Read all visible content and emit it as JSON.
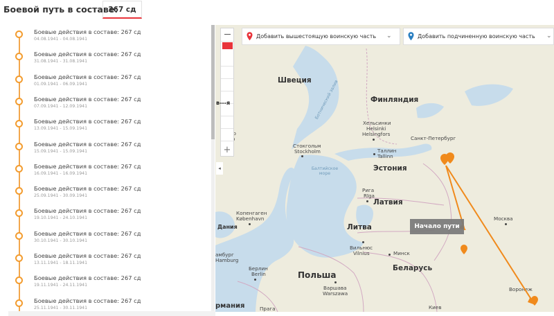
{
  "header": {
    "title": "Боевой путь в составе:",
    "unit_tab": "267 сд"
  },
  "timeline": {
    "items": [
      {
        "title": "Боевые действия в составе: 267 сд",
        "dates": "04.08.1941 - 04.08.1941"
      },
      {
        "title": "Боевые действия в составе: 267 сд",
        "dates": "31.08.1941 - 31.08.1941"
      },
      {
        "title": "Боевые действия в составе: 267 сд",
        "dates": "01.09.1941 - 06.09.1941"
      },
      {
        "title": "Боевые действия в составе: 267 сд",
        "dates": "07.09.1941 - 12.09.1941"
      },
      {
        "title": "Боевые действия в составе: 267 сд",
        "dates": "13.09.1941 - 15.09.1941"
      },
      {
        "title": "Боевые действия в составе: 267 сд",
        "dates": "15.09.1941 - 15.09.1941"
      },
      {
        "title": "Боевые действия в составе: 267 сд",
        "dates": "16.09.1941 - 16.09.1941"
      },
      {
        "title": "Боевые действия в составе: 267 сд",
        "dates": "25.09.1941 - 30.09.1941"
      },
      {
        "title": "Боевые действия в составе: 267 сд",
        "dates": "19.10.1941 - 24.10.1941"
      },
      {
        "title": "Боевые действия в составе: 267 сд",
        "dates": "30.10.1941 - 30.10.1941"
      },
      {
        "title": "Боевые действия в составе: 267 сд",
        "dates": "13.11.1941 - 18.11.1941"
      },
      {
        "title": "Боевые действия в составе: 267 сд",
        "dates": "19.11.1941 - 24.11.1941"
      },
      {
        "title": "Боевые действия в составе: 267 сд",
        "dates": "25.11.1941 - 30.11.1941"
      }
    ]
  },
  "toolbar": {
    "add_parent_label": "Добавить вышестоящую воинскую часть",
    "add_child_label": "Добавить подчиненную воинскую часть",
    "parent_pin_color": "#e8333a",
    "child_pin_color": "#2a7fc1"
  },
  "map": {
    "start_tooltip": "Начало пути",
    "route_color": "#f08a1c",
    "labels": {
      "sweden": "Швеция",
      "finland": "Финляндия",
      "estonia": "Эстония",
      "latvia": "Латвия",
      "lithuania": "Литва",
      "belarus": "Беларусь",
      "poland": "Польша",
      "denmark": "Дания",
      "germany_partial": "рмания",
      "helsinki": "Хельсинки",
      "helsinki_alt": "Helsinki",
      "helsingfors": "Helsingfors",
      "stockholm": "Стокгольм",
      "stockholm_alt": "Stockholm",
      "tallinn": "Таллин",
      "tallinn_alt": "Tallinn",
      "stpetersburg": "Санкт-Петербург",
      "riga": "Рига",
      "riga_alt": "Rīga",
      "copenhagen": "Копенгаген",
      "copenhagen_alt": "København",
      "vilnius": "Вильнюс",
      "vilnius_alt": "Vilnius",
      "minsk": "Минск",
      "moscow": "Москва",
      "berlin": "Берлин",
      "berlin_alt": "Berlin",
      "hamburg": "амбург",
      "hamburg_alt": "Hamburg",
      "warsaw": "Варшава",
      "warsaw_alt": "Warszawa",
      "voronezh": "Воронеж",
      "kiev": "Киев",
      "prague": "Прага",
      "baltic_sea": "Балтийское море",
      "gulf_bothnia": "Ботнический залив",
      "oslo_partial": "lo",
      "oslo_partial2": "слo"
    }
  }
}
